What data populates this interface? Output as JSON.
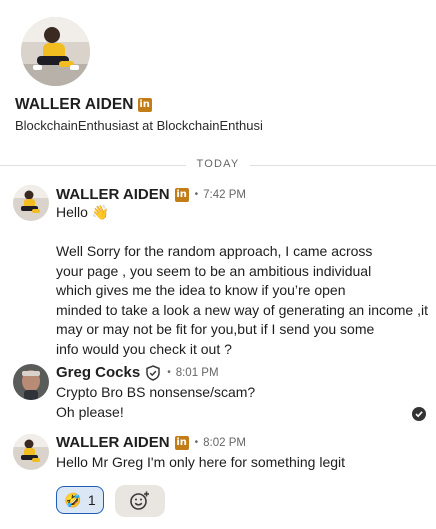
{
  "profile": {
    "name": "WALLER AIDEN",
    "headline": "BlockchainEnthusiast at BlockchainEnthusi",
    "linkedin_badge": "in"
  },
  "divider": {
    "label": "TODAY"
  },
  "messages": [
    {
      "sender": "WALLER AIDEN",
      "badge": "in",
      "separator": "•",
      "time": "7:42 PM",
      "lines": [
        "Hello 👋",
        "",
        "Well Sorry for the random approach, I came across",
        "your page , you seem to be an ambitious individual",
        "which gives me the idea to know if you’re open",
        "minded to take a look a new way of generating an income ,it",
        "may or may not be fit for you,but if I send you some",
        "info would you check it out ?"
      ]
    },
    {
      "sender": "Greg Cocks",
      "separator": "•",
      "time": "8:01 PM",
      "lines": [
        "Crypto Bro BS nonsense/scam?",
        "Oh please!"
      ]
    },
    {
      "sender": "WALLER AIDEN",
      "badge": "in",
      "separator": "•",
      "time": "8:02 PM",
      "lines": [
        "Hello Mr Greg I'm only here for something legit"
      ]
    }
  ],
  "reaction": {
    "emoji": "🤣",
    "count": "1"
  },
  "icons": {
    "verify": "shield-check-icon",
    "read": "read-receipt-check-icon",
    "add_reaction": "add-emoji-icon"
  },
  "colors": {
    "linkedin_badge": "#c37d16",
    "reaction_border": "#1d5fb6",
    "reaction_fill": "#dbe7f5"
  }
}
